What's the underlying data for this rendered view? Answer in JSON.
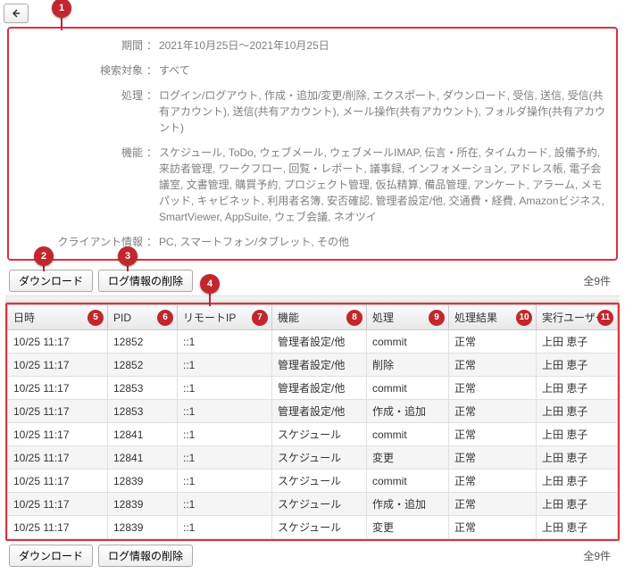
{
  "summary": {
    "period_label": "期間",
    "period_value": "2021年10月25日～2021年10月25日",
    "target_label": "検索対象",
    "target_value": "すべて",
    "process_label": "処理",
    "process_value": "ログイン/ログアウト, 作成・追加/変更/削除, エクスポート, ダウンロード, 受信, 送信, 受信(共有アカウント), 送信(共有アカウント), メール操作(共有アカウント), フォルダ操作(共有アカウント)",
    "feature_label": "機能",
    "feature_value": "スケジュール, ToDo, ウェブメール, ウェブメールIMAP, 伝言・所在, タイムカード, 設備予約, 来訪者管理, ワークフロー, 回覧・レポート, 議事録, インフォメーション, アドレス帳, 電子会議室, 文書管理, 購買予約, プロジェクト管理, 仮払精算, 備品管理, アンケート, アラーム, メモパッド, キャビネット, 利用者名簿, 安否確認, 管理者設定/他, 交通費・経費, Amazonビジネス, SmartViewer, AppSuite, ウェブ会議, ネオツイ",
    "client_label": "クライアント情報",
    "client_value": "PC, スマートフォン/タブレット, その他"
  },
  "buttons": {
    "download": "ダウンロード",
    "delete_log": "ログ情報の削除"
  },
  "count_text": "全9件",
  "headers": {
    "datetime": "日時",
    "pid": "PID",
    "remote_ip": "リモートIP",
    "feature": "機能",
    "process": "処理",
    "result": "処理結果",
    "user": "実行ユーザー"
  },
  "rows": [
    {
      "dt": "10/25 11:17",
      "pid": "12852",
      "ip": "::1",
      "feat": "管理者設定/他",
      "proc": "commit",
      "res": "正常",
      "user": "上田 恵子"
    },
    {
      "dt": "10/25 11:17",
      "pid": "12852",
      "ip": "::1",
      "feat": "管理者設定/他",
      "proc": "削除",
      "res": "正常",
      "user": "上田 恵子"
    },
    {
      "dt": "10/25 11:17",
      "pid": "12853",
      "ip": "::1",
      "feat": "管理者設定/他",
      "proc": "commit",
      "res": "正常",
      "user": "上田 恵子"
    },
    {
      "dt": "10/25 11:17",
      "pid": "12853",
      "ip": "::1",
      "feat": "管理者設定/他",
      "proc": "作成・追加",
      "res": "正常",
      "user": "上田 恵子"
    },
    {
      "dt": "10/25 11:17",
      "pid": "12841",
      "ip": "::1",
      "feat": "スケジュール",
      "proc": "commit",
      "res": "正常",
      "user": "上田 恵子"
    },
    {
      "dt": "10/25 11:17",
      "pid": "12841",
      "ip": "::1",
      "feat": "スケジュール",
      "proc": "変更",
      "res": "正常",
      "user": "上田 恵子"
    },
    {
      "dt": "10/25 11:17",
      "pid": "12839",
      "ip": "::1",
      "feat": "スケジュール",
      "proc": "commit",
      "res": "正常",
      "user": "上田 恵子"
    },
    {
      "dt": "10/25 11:17",
      "pid": "12839",
      "ip": "::1",
      "feat": "スケジュール",
      "proc": "作成・追加",
      "res": "正常",
      "user": "上田 恵子"
    },
    {
      "dt": "10/25 11:17",
      "pid": "12839",
      "ip": "::1",
      "feat": "スケジュール",
      "proc": "変更",
      "res": "正常",
      "user": "上田 恵子"
    }
  ]
}
